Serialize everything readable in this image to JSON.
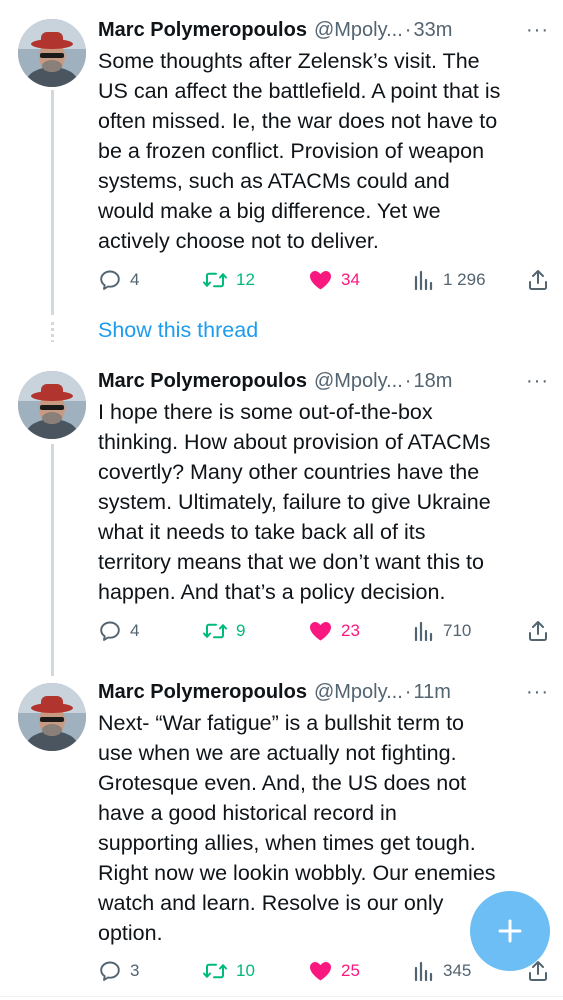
{
  "tweets": [
    {
      "author": "Marc Polymeropoulos",
      "handle": "@Mpoly...",
      "time": "33m",
      "lines": [
        "Some thoughts after Zelensk’s visit. The",
        "US can affect the battlefield. A point that is",
        "often missed.  Ie, the war does not have to",
        "be a frozen conflict. Provision of weapon",
        "systems, such as ATACMs could and",
        "would make a big difference. Yet we",
        "actively choose not to deliver."
      ],
      "replies": "4",
      "retweets": "12",
      "likes": "34",
      "views": "1 296"
    },
    {
      "author": "Marc Polymeropoulos",
      "handle": "@Mpoly...",
      "time": "18m",
      "lines": [
        "I hope there is some out-of-the-box",
        "thinking. How about provision of ATACMs",
        "covertly? Many other countries have the",
        "system. Ultimately, failure to give Ukraine",
        "what it needs to take back all of its",
        "territory means that we don’t want this to",
        "happen. And that’s a policy decision."
      ],
      "replies": "4",
      "retweets": "9",
      "likes": "23",
      "views": "710"
    },
    {
      "author": "Marc Polymeropoulos",
      "handle": "@Mpoly...",
      "time": "11m",
      "lines": [
        "Next- “War fatigue” is a bullshit term to",
        "use when we are actually not fighting.",
        "Grotesque even.  And, the US does not",
        "have a good historical record in",
        "supporting allies, when times get tough.",
        "Right now we lookin wobbly. Our enemies",
        "watch and learn.  Resolve is our only",
        "option."
      ],
      "replies": "3",
      "retweets": "10",
      "likes": "25",
      "views": "345"
    }
  ],
  "show_thread": "Show this thread",
  "more_glyph": "···",
  "separator": "·",
  "colors": {
    "accent": "#1d9bf0",
    "retweet": "#00ba7c",
    "like": "#f91880",
    "muted": "#536471"
  },
  "icons": [
    "reply-icon",
    "retweet-icon",
    "heart-icon",
    "views-icon",
    "share-icon",
    "compose-plus-icon"
  ]
}
